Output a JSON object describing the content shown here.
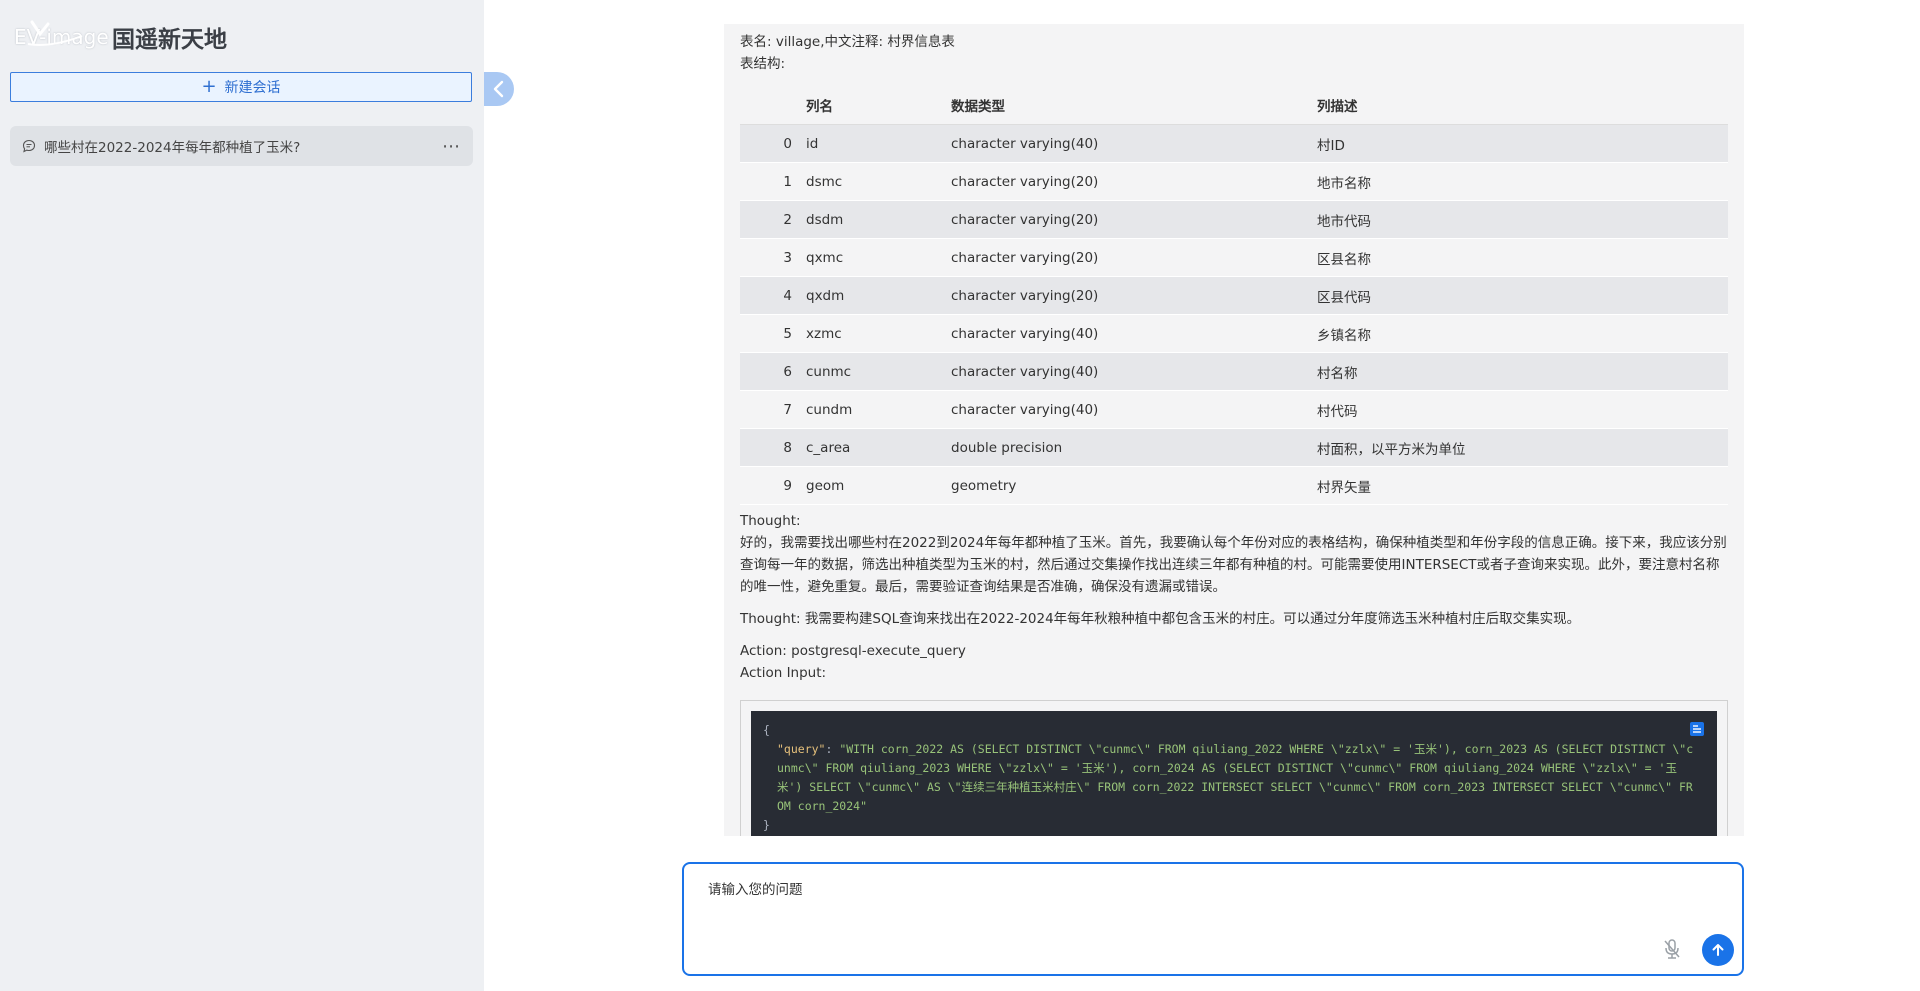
{
  "sidebar": {
    "logo_text": "EV-image",
    "app_title": "国遥新天地",
    "new_chat_label": "新建会话",
    "conversations": [
      {
        "title": "哪些村在2022-2024年每年都种植了玉米?"
      }
    ]
  },
  "message": {
    "table_line": "表名: village,中文注释: 村界信息表",
    "structure_line": "表结构:",
    "columns": [
      "列名",
      "数据类型",
      "列描述"
    ],
    "rows": [
      {
        "idx": "0",
        "name": "id",
        "type": "character varying(40)",
        "desc": "村ID"
      },
      {
        "idx": "1",
        "name": "dsmc",
        "type": "character varying(20)",
        "desc": "地市名称"
      },
      {
        "idx": "2",
        "name": "dsdm",
        "type": "character varying(20)",
        "desc": "地市代码"
      },
      {
        "idx": "3",
        "name": "qxmc",
        "type": "character varying(20)",
        "desc": "区县名称"
      },
      {
        "idx": "4",
        "name": "qxdm",
        "type": "character varying(20)",
        "desc": "区县代码"
      },
      {
        "idx": "5",
        "name": "xzmc",
        "type": "character varying(40)",
        "desc": "乡镇名称"
      },
      {
        "idx": "6",
        "name": "cunmc",
        "type": "character varying(40)",
        "desc": "村名称"
      },
      {
        "idx": "7",
        "name": "cundm",
        "type": "character varying(40)",
        "desc": "村代码"
      },
      {
        "idx": "8",
        "name": "c_area",
        "type": "double precision",
        "desc": "村面积，以平方米为单位"
      },
      {
        "idx": "9",
        "name": "geom",
        "type": "geometry",
        "desc": "村界矢量"
      }
    ],
    "thought_label": "Thought:",
    "thought_text": "好的，我需要找出哪些村在2022到2024年每年都种植了玉米。首先，我要确认每个年份对应的表格结构，确保种植类型和年份字段的信息正确。接下来，我应该分别查询每一年的数据，筛选出种植类型为玉米的村，然后通过交集操作找出连续三年都有种植的村。可能需要使用INTERSECT或者子查询来实现。此外，要注意村名称的唯一性，避免重复。最后，需要验证查询结果是否准确，确保没有遗漏或错误。",
    "thought2": "Thought: 我需要构建SQL查询来找出在2022-2024年每年秋粮种植中都包含玉米的村庄。可以通过分年度筛选玉米种植村庄后取交集实现。",
    "action": "Action: postgresql-execute_query",
    "action_input": "Action Input:",
    "code_open": "{",
    "code_key": "\"query\"",
    "code_value": "\"WITH corn_2022 AS (SELECT DISTINCT \\\"cunmc\\\" FROM qiuliang_2022 WHERE \\\"zzlx\\\" = '玉米'), corn_2023 AS (SELECT DISTINCT \\\"cunmc\\\" FROM qiuliang_2023 WHERE \\\"zzlx\\\" = '玉米'), corn_2024 AS (SELECT DISTINCT \\\"cunmc\\\" FROM qiuliang_2024 WHERE \\\"zzlx\\\" = '玉米') SELECT \\\"cunmc\\\" AS \\\"连续三年种植玉米村庄\\\" FROM corn_2022 INTERSECT SELECT \\\"cunmc\\\" FROM corn_2023 INTERSECT SELECT \\\"cunmc\\\" FROM corn_2024\"",
    "code_close": "}"
  },
  "input": {
    "placeholder": "请输入您的问题"
  },
  "colors": {
    "accent": "#1a73e8",
    "sidebar_bg": "#eef0f3",
    "code_bg": "#282c34"
  }
}
